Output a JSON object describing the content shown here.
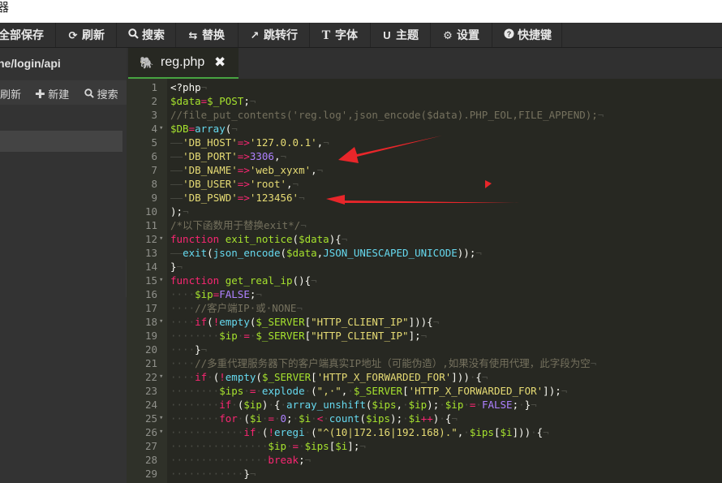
{
  "window": {
    "title": "器"
  },
  "toolbar": {
    "items": [
      {
        "icon": "save-icon",
        "label": "全部保存"
      },
      {
        "icon": "refresh-icon",
        "label": "刷新"
      },
      {
        "icon": "search-icon",
        "label": "搜索"
      },
      {
        "icon": "replace-icon",
        "label": "替换"
      },
      {
        "icon": "goto-line-icon",
        "label": "跳转行"
      },
      {
        "icon": "font-icon",
        "label": "字体"
      },
      {
        "icon": "theme-icon",
        "label": "主题"
      },
      {
        "icon": "gear-icon",
        "label": "设置"
      },
      {
        "icon": "help-icon",
        "label": "快捷键"
      }
    ]
  },
  "sidebar": {
    "path": "ne/login/api",
    "refresh_label": "刷新",
    "new_label": "新建",
    "search_label": "搜索"
  },
  "editor": {
    "tab_name": "reg.php",
    "lines": [
      {
        "n": "1",
        "fold": false
      },
      {
        "n": "2",
        "fold": false
      },
      {
        "n": "3",
        "fold": false
      },
      {
        "n": "4",
        "fold": true
      },
      {
        "n": "5",
        "fold": false
      },
      {
        "n": "6",
        "fold": false
      },
      {
        "n": "7",
        "fold": false
      },
      {
        "n": "8",
        "fold": false
      },
      {
        "n": "9",
        "fold": false
      },
      {
        "n": "10",
        "fold": false
      },
      {
        "n": "11",
        "fold": false
      },
      {
        "n": "12",
        "fold": true
      },
      {
        "n": "13",
        "fold": false
      },
      {
        "n": "14",
        "fold": false
      },
      {
        "n": "15",
        "fold": true
      },
      {
        "n": "16",
        "fold": false
      },
      {
        "n": "17",
        "fold": false
      },
      {
        "n": "18",
        "fold": true
      },
      {
        "n": "19",
        "fold": false
      },
      {
        "n": "20",
        "fold": false
      },
      {
        "n": "21",
        "fold": false
      },
      {
        "n": "22",
        "fold": true
      },
      {
        "n": "23",
        "fold": false
      },
      {
        "n": "24",
        "fold": false
      },
      {
        "n": "25",
        "fold": true
      },
      {
        "n": "26",
        "fold": true
      },
      {
        "n": "27",
        "fold": false
      },
      {
        "n": "28",
        "fold": false
      },
      {
        "n": "29",
        "fold": false
      }
    ],
    "code": [
      [
        [
          "w",
          "<?php"
        ],
        [
          "ws",
          "¬"
        ]
      ],
      [
        [
          "v",
          "$data"
        ],
        [
          "k",
          "="
        ],
        [
          "v",
          "$_POST"
        ],
        [
          "w",
          ";"
        ],
        [
          "ws",
          "¬"
        ]
      ],
      [
        [
          "c",
          "//file_put_contents('reg.log',json_encode($data).PHP_EOL,FILE_APPEND);"
        ],
        [
          "ws",
          "¬"
        ]
      ],
      [
        [
          "v",
          "$DB"
        ],
        [
          "k",
          "="
        ],
        [
          "f",
          "array"
        ],
        [
          "w",
          "("
        ],
        [
          "ws",
          "¬"
        ]
      ],
      [
        [
          "ws",
          "——"
        ],
        [
          "s",
          "'DB_HOST'"
        ],
        [
          "k",
          "=>"
        ],
        [
          "s",
          "'127.0.0.1'"
        ],
        [
          "w",
          ","
        ],
        [
          "ws",
          "¬"
        ]
      ],
      [
        [
          "ws",
          "——"
        ],
        [
          "s",
          "'DB_PORT'"
        ],
        [
          "k",
          "=>"
        ],
        [
          "n",
          "3306"
        ],
        [
          "w",
          ","
        ],
        [
          "ws",
          "¬"
        ]
      ],
      [
        [
          "ws",
          "——"
        ],
        [
          "s",
          "'DB_NAME'"
        ],
        [
          "k",
          "=>"
        ],
        [
          "s",
          "'web_xyxm'"
        ],
        [
          "w",
          ","
        ],
        [
          "ws",
          "¬"
        ]
      ],
      [
        [
          "ws",
          "——"
        ],
        [
          "s",
          "'DB_USER'"
        ],
        [
          "k",
          "=>"
        ],
        [
          "s",
          "'root'"
        ],
        [
          "w",
          ","
        ],
        [
          "ws",
          "¬"
        ]
      ],
      [
        [
          "ws",
          "——"
        ],
        [
          "s",
          "'DB_PSWD'"
        ],
        [
          "k",
          "=>"
        ],
        [
          "s",
          "'123456'"
        ],
        [
          "ws",
          "¬"
        ]
      ],
      [
        [
          "w",
          ");"
        ],
        [
          "ws",
          "¬"
        ]
      ],
      [
        [
          "c",
          "/*以下函数用于替换exit*/"
        ],
        [
          "ws",
          "¬"
        ]
      ],
      [
        [
          "k",
          "function"
        ],
        [
          "w",
          " "
        ],
        [
          "v",
          "exit_notice"
        ],
        [
          "w",
          "("
        ],
        [
          "v",
          "$data"
        ],
        [
          "w",
          "){"
        ],
        [
          "ws",
          "¬"
        ]
      ],
      [
        [
          "ws",
          "——"
        ],
        [
          "f",
          "exit"
        ],
        [
          "w",
          "("
        ],
        [
          "f",
          "json_encode"
        ],
        [
          "w",
          "("
        ],
        [
          "v",
          "$data"
        ],
        [
          "w",
          ","
        ],
        [
          "f",
          "JSON_UNESCAPED_UNICODE"
        ],
        [
          "w",
          "));"
        ],
        [
          "ws",
          "¬"
        ]
      ],
      [
        [
          "w",
          "}"
        ],
        [
          "ws",
          "¬"
        ]
      ],
      [
        [
          "k",
          "function"
        ],
        [
          "w",
          " "
        ],
        [
          "v",
          "get_real_ip"
        ],
        [
          "w",
          "(){"
        ],
        [
          "ws",
          "¬"
        ]
      ],
      [
        [
          "ws",
          "····"
        ],
        [
          "v",
          "$ip"
        ],
        [
          "k",
          "="
        ],
        [
          "n",
          "FALSE"
        ],
        [
          "w",
          ";"
        ],
        [
          "ws",
          "¬"
        ]
      ],
      [
        [
          "ws",
          "····"
        ],
        [
          "c",
          "//客户端IP·或·NONE"
        ],
        [
          "ws",
          "¬"
        ]
      ],
      [
        [
          "ws",
          "····"
        ],
        [
          "k",
          "if"
        ],
        [
          "w",
          "("
        ],
        [
          "k",
          "!"
        ],
        [
          "f",
          "empty"
        ],
        [
          "w",
          "("
        ],
        [
          "v",
          "$_SERVER"
        ],
        [
          "w",
          "["
        ],
        [
          "s",
          "\"HTTP_CLIENT_IP\""
        ],
        [
          "w",
          "])){"
        ],
        [
          "ws",
          "¬"
        ]
      ],
      [
        [
          "ws",
          "········"
        ],
        [
          "v",
          "$ip"
        ],
        [
          "ws",
          "·"
        ],
        [
          "k",
          "="
        ],
        [
          "ws",
          "·"
        ],
        [
          "v",
          "$_SERVER"
        ],
        [
          "w",
          "["
        ],
        [
          "s",
          "\"HTTP_CLIENT_IP\""
        ],
        [
          "w",
          "];"
        ],
        [
          "ws",
          "¬"
        ]
      ],
      [
        [
          "ws",
          "····"
        ],
        [
          "w",
          "}"
        ],
        [
          "ws",
          "¬"
        ]
      ],
      [
        [
          "ws",
          "····"
        ],
        [
          "c",
          "//多重代理服务器下的客户端真实IP地址（可能伪造）,如果没有使用代理，此字段为空"
        ],
        [
          "ws",
          "¬"
        ]
      ],
      [
        [
          "ws",
          "····"
        ],
        [
          "k",
          "if"
        ],
        [
          "ws",
          "·"
        ],
        [
          "w",
          "("
        ],
        [
          "k",
          "!"
        ],
        [
          "f",
          "empty"
        ],
        [
          "w",
          "("
        ],
        [
          "v",
          "$_SERVER"
        ],
        [
          "w",
          "["
        ],
        [
          "s",
          "'HTTP_X_FORWARDED_FOR'"
        ],
        [
          "w",
          "]))"
        ],
        [
          "ws",
          "·"
        ],
        [
          "w",
          "{"
        ],
        [
          "ws",
          "¬"
        ]
      ],
      [
        [
          "ws",
          "········"
        ],
        [
          "v",
          "$ips"
        ],
        [
          "ws",
          "·"
        ],
        [
          "k",
          "="
        ],
        [
          "ws",
          "·"
        ],
        [
          "f",
          "explode"
        ],
        [
          "ws",
          "·"
        ],
        [
          "w",
          "("
        ],
        [
          "s",
          "\",·\""
        ],
        [
          "w",
          ","
        ],
        [
          "ws",
          "·"
        ],
        [
          "v",
          "$_SERVER"
        ],
        [
          "w",
          "["
        ],
        [
          "s",
          "'HTTP_X_FORWARDED_FOR'"
        ],
        [
          "w",
          "]);"
        ],
        [
          "ws",
          "¬"
        ]
      ],
      [
        [
          "ws",
          "········"
        ],
        [
          "k",
          "if"
        ],
        [
          "ws",
          "·"
        ],
        [
          "w",
          "("
        ],
        [
          "v",
          "$ip"
        ],
        [
          "w",
          ")"
        ],
        [
          "ws",
          "·"
        ],
        [
          "w",
          "{"
        ],
        [
          "ws",
          "·"
        ],
        [
          "f",
          "array_unshift"
        ],
        [
          "w",
          "("
        ],
        [
          "v",
          "$ips"
        ],
        [
          "w",
          ","
        ],
        [
          "ws",
          "·"
        ],
        [
          "v",
          "$ip"
        ],
        [
          "w",
          ");"
        ],
        [
          "ws",
          "·"
        ],
        [
          "v",
          "$ip"
        ],
        [
          "ws",
          "·"
        ],
        [
          "k",
          "="
        ],
        [
          "ws",
          "·"
        ],
        [
          "n",
          "FALSE"
        ],
        [
          "w",
          ";"
        ],
        [
          "ws",
          "·"
        ],
        [
          "w",
          "}"
        ],
        [
          "ws",
          "¬"
        ]
      ],
      [
        [
          "ws",
          "········"
        ],
        [
          "k",
          "for"
        ],
        [
          "ws",
          "·"
        ],
        [
          "w",
          "("
        ],
        [
          "v",
          "$i"
        ],
        [
          "ws",
          "·"
        ],
        [
          "k",
          "="
        ],
        [
          "ws",
          "·"
        ],
        [
          "n",
          "0"
        ],
        [
          "w",
          ";"
        ],
        [
          "ws",
          "·"
        ],
        [
          "v",
          "$i"
        ],
        [
          "ws",
          "·"
        ],
        [
          "k",
          "<"
        ],
        [
          "ws",
          "·"
        ],
        [
          "f",
          "count"
        ],
        [
          "w",
          "("
        ],
        [
          "v",
          "$ips"
        ],
        [
          "w",
          ");"
        ],
        [
          "ws",
          "·"
        ],
        [
          "v",
          "$i"
        ],
        [
          "k",
          "++"
        ],
        [
          "w",
          ")"
        ],
        [
          "ws",
          "·"
        ],
        [
          "w",
          "{"
        ],
        [
          "ws",
          "¬"
        ]
      ],
      [
        [
          "ws",
          "············"
        ],
        [
          "k",
          "if"
        ],
        [
          "ws",
          "·"
        ],
        [
          "w",
          "("
        ],
        [
          "k",
          "!"
        ],
        [
          "f",
          "eregi"
        ],
        [
          "ws",
          "·"
        ],
        [
          "w",
          "("
        ],
        [
          "s",
          "\"^(10|172.16|192.168).\""
        ],
        [
          "w",
          ","
        ],
        [
          "ws",
          "·"
        ],
        [
          "v",
          "$ips"
        ],
        [
          "w",
          "["
        ],
        [
          "v",
          "$i"
        ],
        [
          "w",
          "]))"
        ],
        [
          "ws",
          "·"
        ],
        [
          "w",
          "{"
        ],
        [
          "ws",
          "¬"
        ]
      ],
      [
        [
          "ws",
          "················"
        ],
        [
          "v",
          "$ip"
        ],
        [
          "ws",
          "·"
        ],
        [
          "k",
          "="
        ],
        [
          "ws",
          "·"
        ],
        [
          "v",
          "$ips"
        ],
        [
          "w",
          "["
        ],
        [
          "v",
          "$i"
        ],
        [
          "w",
          "];"
        ],
        [
          "ws",
          "¬"
        ]
      ],
      [
        [
          "ws",
          "················"
        ],
        [
          "k",
          "break"
        ],
        [
          "w",
          ";"
        ],
        [
          "ws",
          "¬"
        ]
      ],
      [
        [
          "ws",
          "············"
        ],
        [
          "w",
          "}"
        ],
        [
          "ws",
          "¬"
        ]
      ]
    ]
  },
  "colors": {
    "accent": "#47a341",
    "arrow": "#e8262a",
    "editor_bg": "#272822"
  }
}
